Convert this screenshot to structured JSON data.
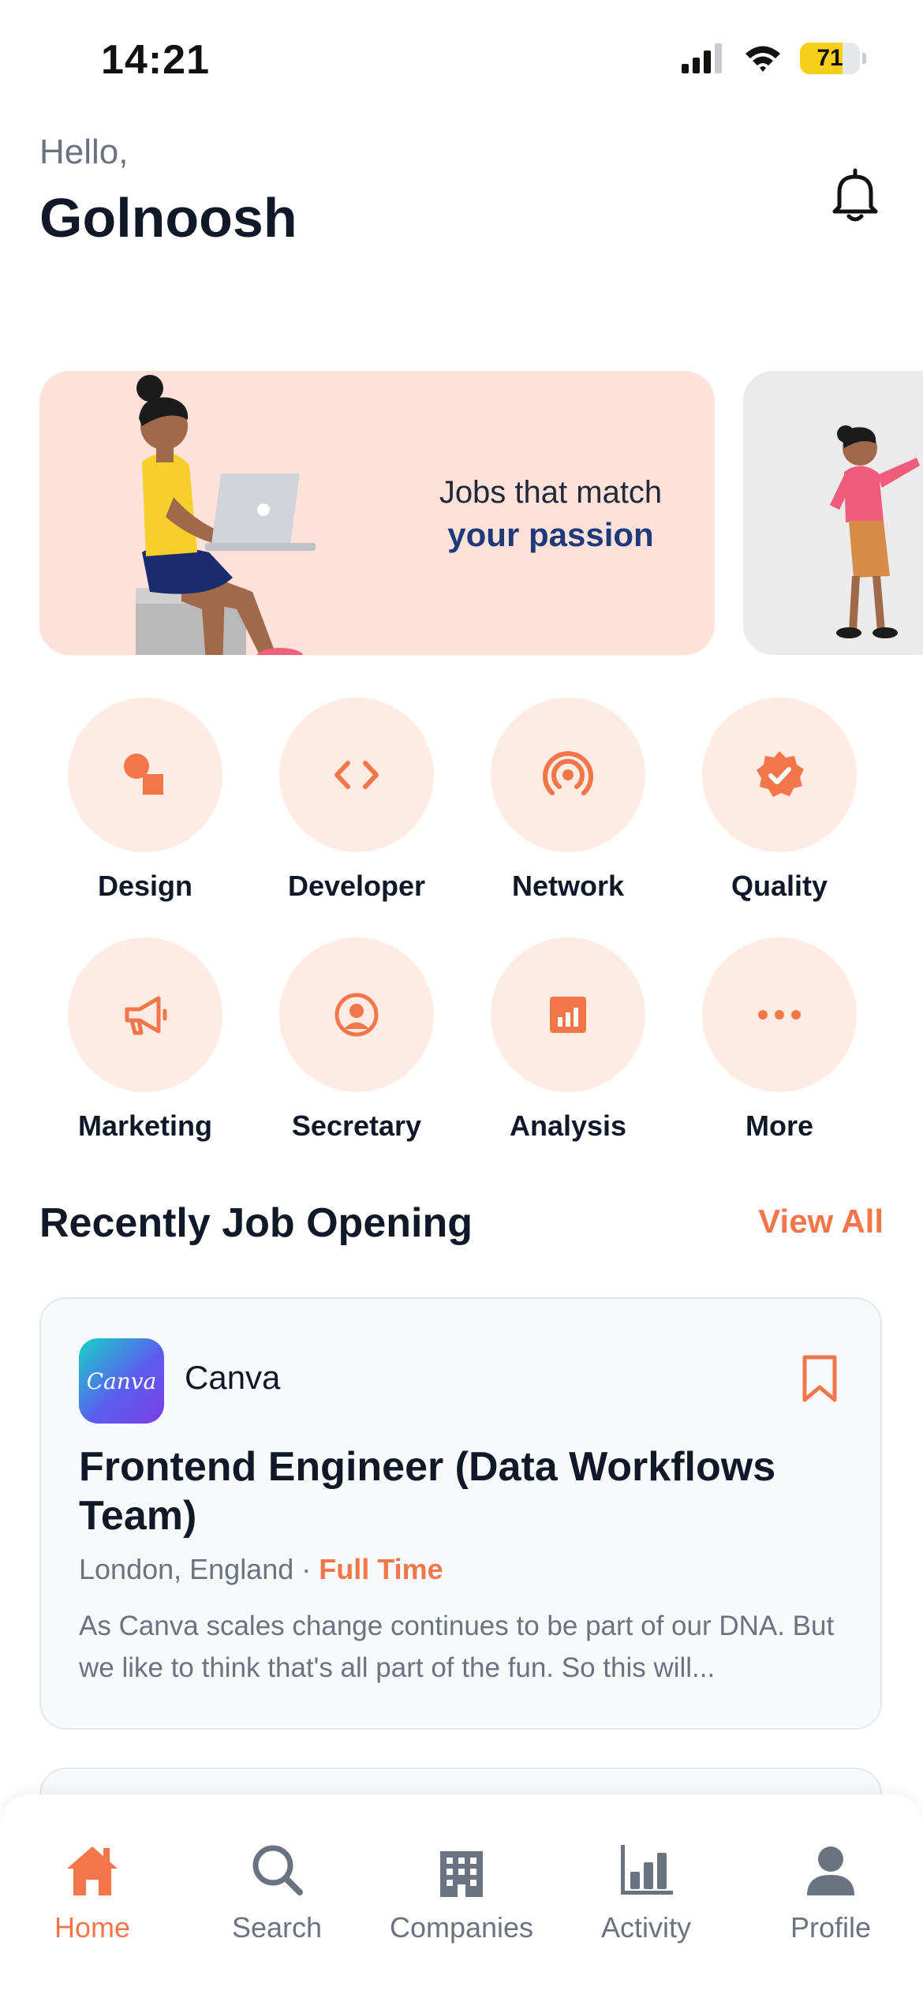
{
  "status_bar": {
    "time": "14:21",
    "battery": "71",
    "battery_level": 0.71
  },
  "header": {
    "greeting": "Hello,",
    "user_name": "Golnoosh"
  },
  "banner": {
    "headline": "Jobs that match",
    "highlight": "your passion"
  },
  "categories": [
    {
      "label": "Design",
      "icon": "shapes-icon"
    },
    {
      "label": "Developer",
      "icon": "code-icon"
    },
    {
      "label": "Network",
      "icon": "signal-icon"
    },
    {
      "label": "Quality",
      "icon": "verified-badge-icon"
    },
    {
      "label": "Marketing",
      "icon": "megaphone-icon"
    },
    {
      "label": "Secretary",
      "icon": "user-circle-icon"
    },
    {
      "label": "Analysis",
      "icon": "bar-chart-icon"
    },
    {
      "label": "More",
      "icon": "more-dots-icon"
    }
  ],
  "recent": {
    "title": "Recently Job Opening",
    "view_all": "View All"
  },
  "job": {
    "company": "Canva",
    "logo_text": "Canva",
    "title": "Frontend Engineer (Data Workflows Team)",
    "location": "London, England",
    "separator": "·",
    "type": "Full Time",
    "description": "As Canva scales change continues to be part of our DNA. But we like to think that's all part of the fun. So this will..."
  },
  "nav": [
    {
      "label": "Home",
      "icon": "home-icon",
      "active": true
    },
    {
      "label": "Search",
      "icon": "search-icon",
      "active": false
    },
    {
      "label": "Companies",
      "icon": "building-icon",
      "active": false
    },
    {
      "label": "Activity",
      "icon": "activity-chart-icon",
      "active": false
    },
    {
      "label": "Profile",
      "icon": "profile-icon",
      "active": false
    }
  ],
  "colors": {
    "accent": "#f27649",
    "accent_soft": "#fdebe4",
    "banner_bg": "#fee2da",
    "text_dark": "#111827",
    "text_muted": "#6b7280"
  }
}
